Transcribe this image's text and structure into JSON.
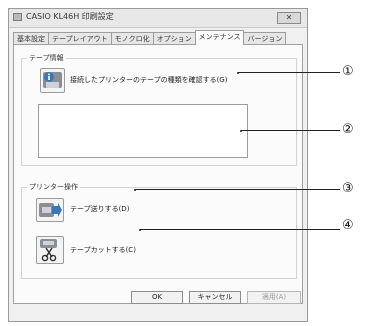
{
  "window": {
    "title": "CASIO KL46H 印刷設定",
    "close_glyph": "✕"
  },
  "tabs": [
    {
      "label": "基本設定",
      "active": false
    },
    {
      "label": "テープレイアウト",
      "active": false
    },
    {
      "label": "モノクロ化",
      "active": false
    },
    {
      "label": "オプション",
      "active": false
    },
    {
      "label": "メンテナンス",
      "active": true
    },
    {
      "label": "バージョン",
      "active": false
    }
  ],
  "tape_info": {
    "group_label": "テープ情報",
    "check_label": "接続したプリンターのテープの種類を確認する(G)",
    "check_icon": "info-printer-icon",
    "info_text": ""
  },
  "printer_ops": {
    "group_label": "プリンター操作",
    "feed_label": "テープ送りする(D)",
    "feed_icon": "tape-feed-icon",
    "cut_label": "テープカットする(C)",
    "cut_icon": "scissors-icon"
  },
  "footer": {
    "ok_label": "OK",
    "cancel_label": "キャンセル",
    "apply_label": "適用(A)"
  },
  "callouts": {
    "c1": "①",
    "c2": "②",
    "c3": "③",
    "c4": "④"
  },
  "colors": {
    "icon_blue": "#3a78b5",
    "icon_gray": "#8a8f96",
    "window_bg": "#f0f0f0"
  }
}
